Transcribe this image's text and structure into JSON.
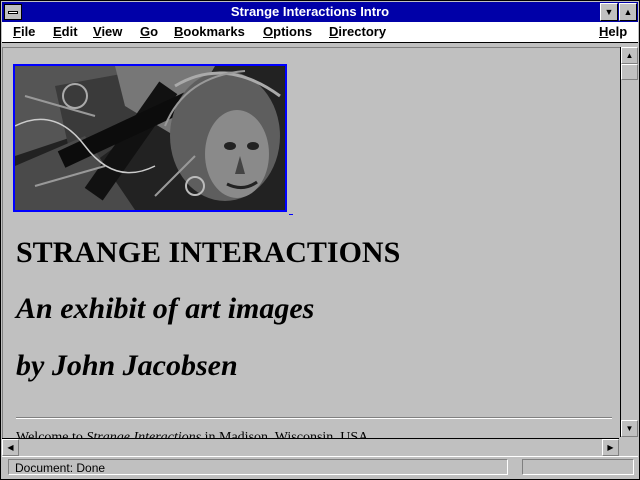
{
  "window": {
    "title": "Strange Interactions Intro"
  },
  "menubar": {
    "items": [
      "File",
      "Edit",
      "View",
      "Go",
      "Bookmarks",
      "Options",
      "Directory"
    ],
    "help": "Help"
  },
  "page": {
    "heading": "STRANGE INTERACTIONS",
    "subtitle": "An exhibit of art images",
    "byline": "by John Jacobsen",
    "welcome_prefix": "Welcome to ",
    "welcome_italic": "Strange Interactions",
    "welcome_suffix": " in Madison, Wisconsin, USA."
  },
  "statusbar": {
    "text": "Document: Done"
  },
  "icons": {
    "system_menu": "system-menu-icon",
    "minimize": "triangle-down",
    "maximize": "triangle-up"
  }
}
